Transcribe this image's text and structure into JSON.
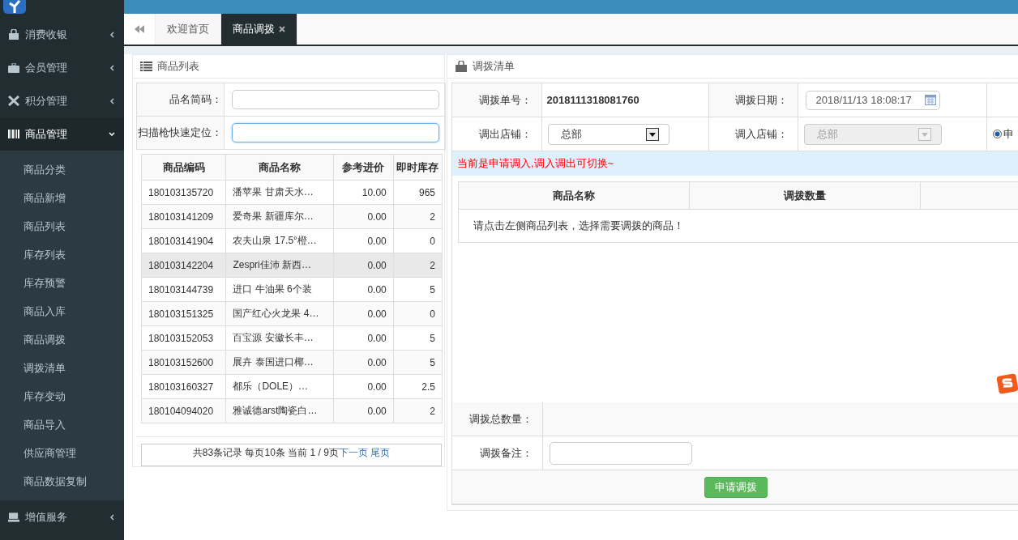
{
  "sidebar": {
    "menus": [
      {
        "label": "消费收银",
        "expanded": false
      },
      {
        "label": "会员管理",
        "expanded": false
      },
      {
        "label": "积分管理",
        "expanded": false
      },
      {
        "label": "商品管理",
        "expanded": true,
        "children": [
          {
            "label": "商品分类"
          },
          {
            "label": "商品新增"
          },
          {
            "label": "商品列表"
          },
          {
            "label": "库存列表"
          },
          {
            "label": "库存预警"
          },
          {
            "label": "商品入库"
          },
          {
            "label": "商品调拨"
          },
          {
            "label": "调拨清单"
          },
          {
            "label": "库存变动"
          },
          {
            "label": "商品导入"
          },
          {
            "label": "供应商管理"
          },
          {
            "label": "商品数据复制"
          }
        ]
      },
      {
        "label": "增值服务",
        "expanded": false
      }
    ]
  },
  "tabs": [
    {
      "label": "欢迎首页",
      "selected": false,
      "closable": false
    },
    {
      "label": "商品调拨",
      "selected": true,
      "closable": true
    }
  ],
  "goods_panel": {
    "title": "商品列表",
    "filters": [
      {
        "label": "品名简码：",
        "focused": false
      },
      {
        "label": "扫描枪快速定位：",
        "focused": true
      }
    ],
    "columns": [
      "商品编码",
      "商品名称",
      "参考进价",
      "即时库存"
    ],
    "rows": [
      {
        "cells": [
          "180103135720",
          "潘苹果 甘肃天水…",
          "10.00",
          "965"
        ],
        "highlighted": false
      },
      {
        "cells": [
          "180103141209",
          "爱奇果 新疆库尔…",
          "0.00",
          "2"
        ],
        "highlighted": false
      },
      {
        "cells": [
          "180103141904",
          "农夫山泉 17.5°橙…",
          "0.00",
          "0"
        ],
        "highlighted": false
      },
      {
        "cells": [
          "180103142204",
          "Zespri佳沛 新西…",
          "0.00",
          "2"
        ],
        "highlighted": true
      },
      {
        "cells": [
          "180103144739",
          "进口 牛油果 6个装",
          "0.00",
          "5"
        ],
        "highlighted": false
      },
      {
        "cells": [
          "180103151325",
          "国产红心火龙果 4…",
          "0.00",
          "0"
        ],
        "highlighted": false
      },
      {
        "cells": [
          "180103152053",
          "百宝源 安徽长丰…",
          "0.00",
          "5"
        ],
        "highlighted": false
      },
      {
        "cells": [
          "180103152600",
          "展卉 泰国进口椰…",
          "0.00",
          "5"
        ],
        "highlighted": false
      },
      {
        "cells": [
          "180103160327",
          "都乐（DOLE）…",
          "0.00",
          "2.5"
        ],
        "highlighted": false
      },
      {
        "cells": [
          "180104094020",
          "雅诚德arst陶瓷白…",
          "0.00",
          "2"
        ],
        "highlighted": false
      }
    ],
    "pagination": {
      "summary": "共83条记录 每页10条 当前 1 / 9页",
      "links": [
        "下一页",
        "尾页"
      ]
    }
  },
  "transfer_panel": {
    "title": "调拨清单",
    "order_no": {
      "label": "调拨单号：",
      "value": "2018111318081760"
    },
    "date": {
      "label": "调拨日期：",
      "value": "2018/11/13 18:08:17"
    },
    "stores": [
      {
        "label": "调出店铺：",
        "value": "总部",
        "disabled": false
      },
      {
        "label": "调入店铺：",
        "value": "总部",
        "disabled": true
      }
    ],
    "mode": {
      "label": "申",
      "selected": true
    },
    "notice": "当前是申请调入,调入调出可切换~",
    "columns": [
      "商品名称",
      "调拨数量"
    ],
    "empty_message": "请点击左侧商品列表，选择需要调拨的商品！",
    "total_label": "调拨总数量：",
    "remark_label": "调拨备注：",
    "submit": "申请调拨"
  }
}
